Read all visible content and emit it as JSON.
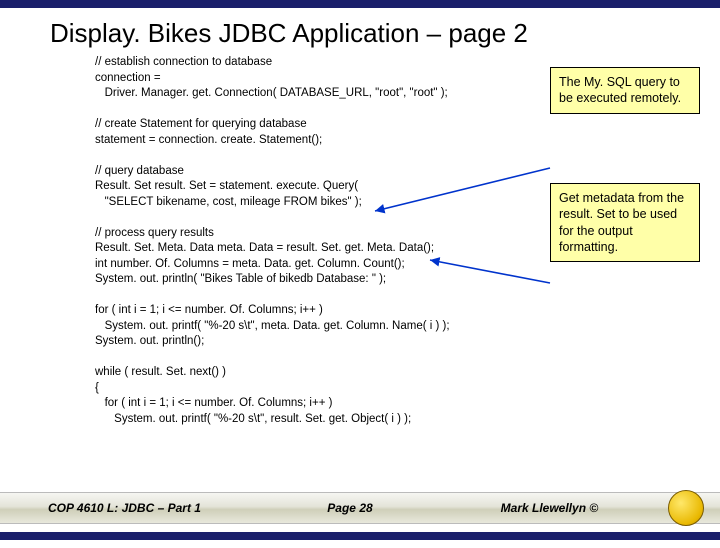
{
  "title": "Display. Bikes JDBC Application – page 2",
  "code_lines": [
    "// establish connection to database",
    "connection =",
    "   Driver. Manager. get. Connection( DATABASE_URL, \"root\", \"root\" );",
    "",
    "// create Statement for querying database",
    "statement = connection. create. Statement();",
    "",
    "// query database",
    "Result. Set result. Set = statement. execute. Query(",
    "   \"SELECT bikename, cost, mileage FROM bikes\" );",
    "",
    "// process query results",
    "Result. Set. Meta. Data meta. Data = result. Set. get. Meta. Data();",
    "int number. Of. Columns = meta. Data. get. Column. Count();",
    "System. out. println( \"Bikes Table of bikedb Database: \" );",
    "",
    "for ( int i = 1; i <= number. Of. Columns; i++ )",
    "   System. out. printf( \"%-20 s\\t\", meta. Data. get. Column. Name( i ) );",
    "System. out. println();",
    "",
    "while ( result. Set. next() )",
    "{",
    "   for ( int i = 1; i <= number. Of. Columns; i++ )",
    "      System. out. printf( \"%-20 s\\t\", result. Set. get. Object( i ) );"
  ],
  "callouts": {
    "c1": "The My. SQL query to be executed remotely.",
    "c2": "Get metadata from the result. Set to be used for the output formatting."
  },
  "footer": {
    "left": "COP 4610 L: JDBC – Part 1",
    "center": "Page 28",
    "right": "Mark Llewellyn ©"
  }
}
